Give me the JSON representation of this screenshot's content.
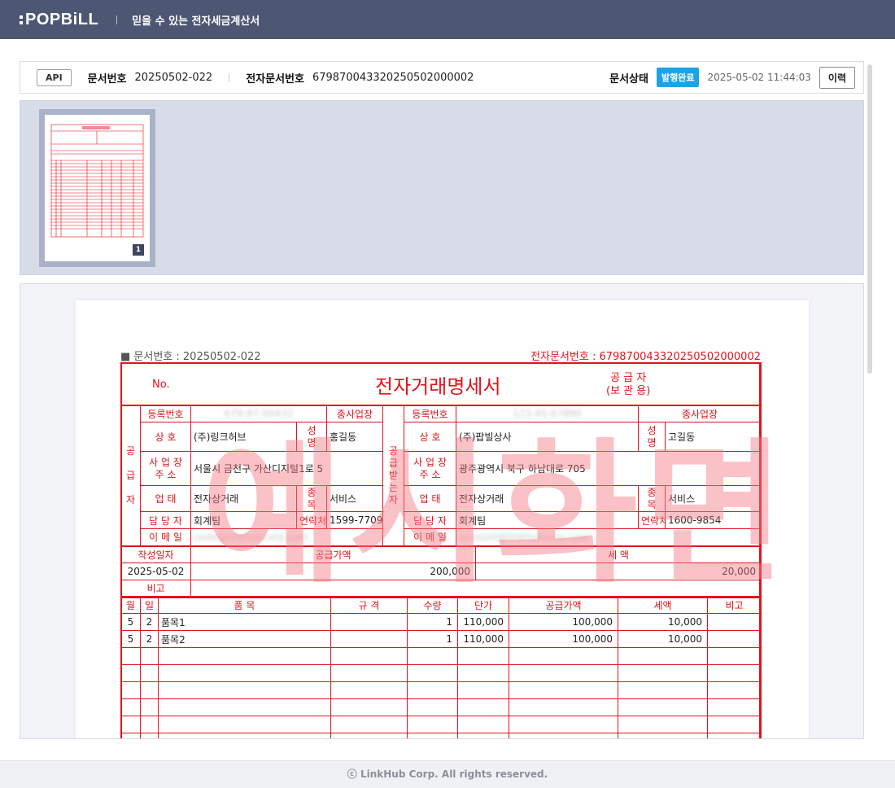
{
  "header": {
    "brand": "POPBiLL",
    "tagline": "믿을 수 있는 전자세금계산서"
  },
  "infobar": {
    "api_badge": "API",
    "doc_no_label": "문서번호",
    "doc_no": "20250502-022",
    "edoc_no_label": "전자문서번호",
    "edoc_no": "67987004332025050200000​2",
    "status_label": "문서상태",
    "status": "발행완료",
    "status_time": "2025-05-02 11:44:03",
    "history_label": "이력"
  },
  "thumbnail": {
    "page_number": "1"
  },
  "document": {
    "doc_no_line": "■ 문서번호 : 20250502-022",
    "edoc_no_line": "전자문서번호 : 67987004332025050200000​2",
    "no_label": "No.",
    "title": "전자거래명세서",
    "copy_label_1": "공 급 자",
    "copy_label_2": "(보 관 용)",
    "supplier": {
      "side_label": "공\n\n급\n\n자",
      "reg_label": "등록번호",
      "reg_value": "679-87-00432",
      "branch_label": "종사업장",
      "name_label": "상      호",
      "name_value": "(주)링크허브",
      "ceo_label": "성\n명",
      "ceo_value": "홍길동",
      "addr_label": "사 업 장\n주      소",
      "addr_value": "서울시 금천구 가산디지털1로 5",
      "biz_label": "업      태",
      "biz_value": "전자상거래",
      "item_label": "종\n목",
      "item_value": "서비스",
      "contact_label": "담 당 자",
      "contact_value": "회계팀",
      "tel_label": "연락처",
      "tel_value": "1599-7709",
      "email_label": "이 메 일",
      "email_value": "code@linkhubcorp.com"
    },
    "buyer": {
      "side_label": "공\n급\n받\n는\n자",
      "reg_label": "등록번호",
      "reg_value": "123-45-67890",
      "branch_label": "종사업장",
      "name_label": "상      호",
      "name_value": "(주)팝빌상사",
      "ceo_label": "성\n명",
      "ceo_value": "고길동",
      "addr_label": "사 업 장\n주      소",
      "addr_value": "광주광역시 북구 하남대로 705",
      "biz_label": "업      태",
      "biz_value": "전자상거래",
      "item_label": "종\n목",
      "item_value": "서비스",
      "contact_label": "담 당 자",
      "contact_value": "회계팀",
      "tel_label": "연락처",
      "tel_value": "1600-9854",
      "email_label": "이 메 일",
      "email_value": "account@linkhubcorp.com"
    },
    "summary": {
      "date_label": "작성일자",
      "supply_label": "공급가액",
      "tax_label": "세      액",
      "date_value": "2025-05-02",
      "supply_value": "200,000",
      "tax_value": "20,000",
      "remark_label": "비고"
    },
    "items_header": [
      "월",
      "일",
      "품      목",
      "규      격",
      "수량",
      "단가",
      "공급가액",
      "세액",
      "비고"
    ],
    "items": [
      {
        "month": "5",
        "day": "2",
        "name": "품목1",
        "spec": "",
        "qty": "1",
        "price": "110,000",
        "supply": "100,000",
        "tax": "10,000",
        "note": ""
      },
      {
        "month": "5",
        "day": "2",
        "name": "품목2",
        "spec": "",
        "qty": "1",
        "price": "110,000",
        "supply": "100,000",
        "tax": "10,000",
        "note": ""
      }
    ],
    "watermark": "예시화면"
  },
  "footer": {
    "copyright": "ⓒ LinkHub Corp. All rights reserved."
  }
}
